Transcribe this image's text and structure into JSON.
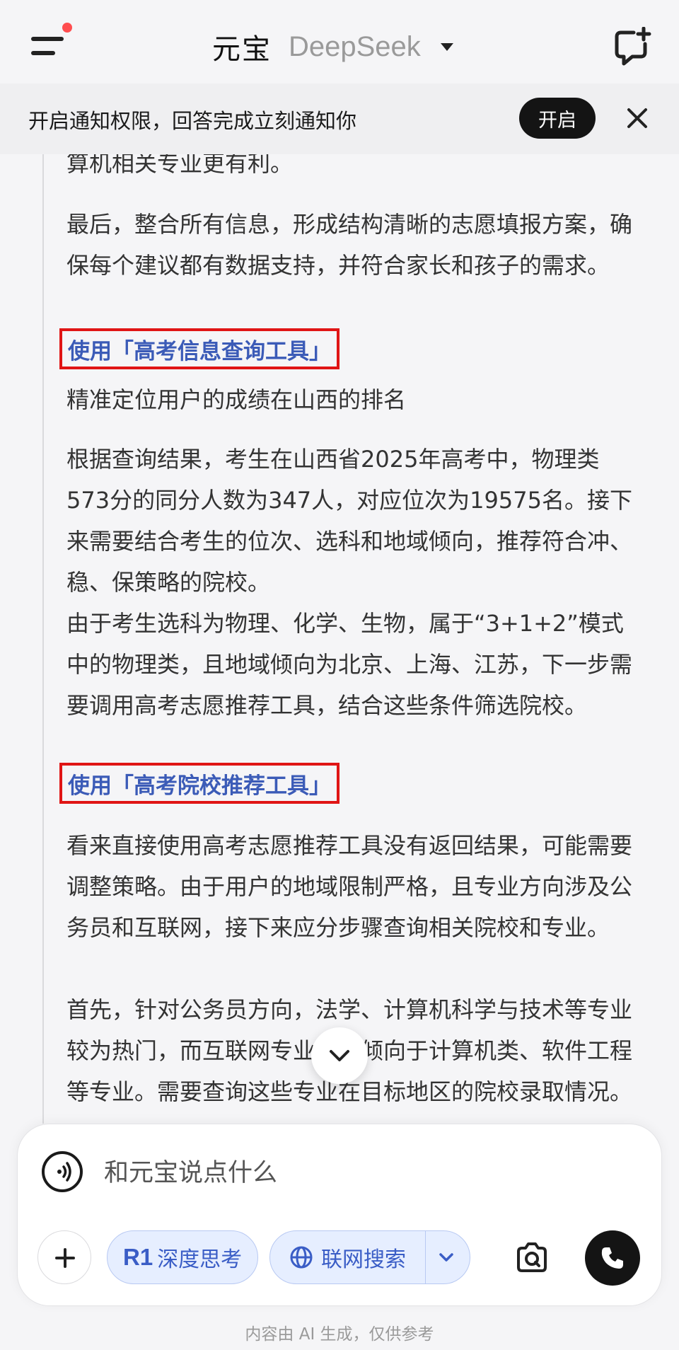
{
  "header": {
    "title": "元宝",
    "model": "DeepSeek",
    "menu_icon": "menu-icon",
    "new_chat_icon": "new-chat-icon"
  },
  "banner": {
    "text": "开启通知权限，回答完成立刻通知你",
    "button_label": "开启",
    "close_icon": "close-icon"
  },
  "content": {
    "paragraphs": [
      "算机相关专业更有利。",
      "最后，整合所有信息，形成结构清晰的志愿填报方案，确保每个建议都有数据支持，并符合家长和孩子的需求。",
      "精准定位用户的成绩在山西的排名",
      "根据查询结果，考生在山西省2025年高考中，物理类573分的同分人数为347人，对应位次为19575名。接下来需要结合考生的位次、选科和地域倾向，推荐符合冲、稳、保策略的院校。",
      "由于考生选科为物理、化学、生物，属于“3+1+2”模式中的物理类，且地域倾向为北京、上海、江苏，下一步需要调用高考志愿推荐工具，结合这些条件筛选院校。",
      "看来直接使用高考志愿推荐工具没有返回结果，可能需要调整策略。由于用户的地域限制严格，且专业方向涉及公务员和互联网，接下来应分步骤查询相关院校和专业。",
      "首先，针对公务员方向，法学、计算机科学与技术等专业较为热门，而互联网专业则更倾向于计算机类、软件工程等专业。需要查询这些专业在目标地区的院校录取情况。"
    ],
    "tool_links": [
      "使用「高考信息查询工具」",
      "使用「高考院校推荐工具」"
    ]
  },
  "input": {
    "placeholder": "和元宝说点什么",
    "deep_think_prefix": "R1",
    "deep_think_label": "深度思考",
    "web_search_label": "联网搜索"
  },
  "footer": {
    "disclaimer": "内容由 AI 生成，仅供参考"
  },
  "colors": {
    "accent": "#3a5dc6",
    "highlight_box": "#e01515",
    "link": "#3b5bb7",
    "dark_button": "#141414"
  }
}
